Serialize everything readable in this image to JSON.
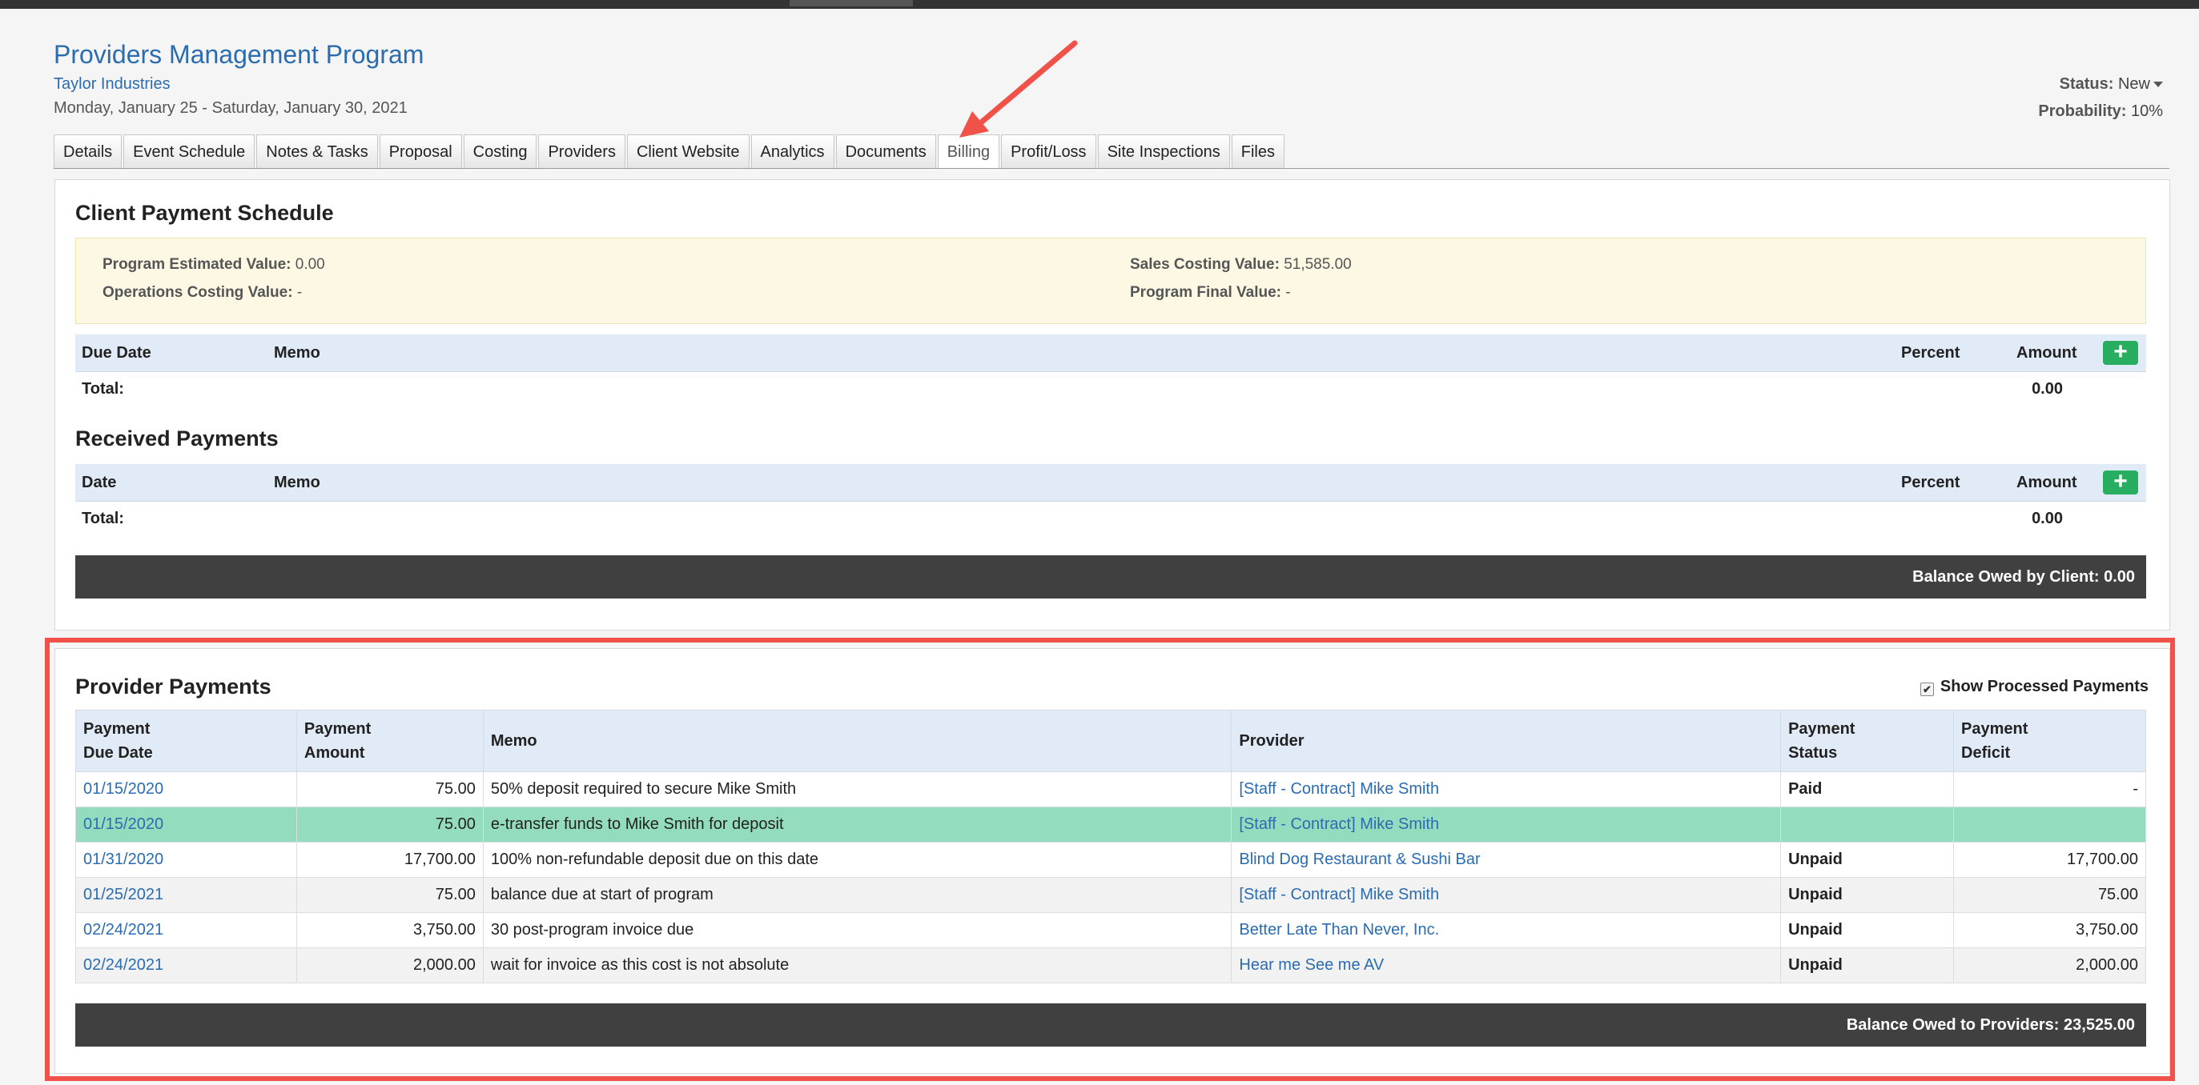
{
  "header": {
    "title": "Providers Management Program",
    "client": "Taylor Industries",
    "dates": "Monday, January 25 - Saturday, January 30, 2021",
    "status_label": "Status:",
    "status_value": "New",
    "probability_label": "Probability:",
    "probability_value": "10%"
  },
  "tabs": [
    {
      "label": "Details"
    },
    {
      "label": "Event Schedule"
    },
    {
      "label": "Notes & Tasks"
    },
    {
      "label": "Proposal"
    },
    {
      "label": "Costing"
    },
    {
      "label": "Providers"
    },
    {
      "label": "Client Website"
    },
    {
      "label": "Analytics"
    },
    {
      "label": "Documents"
    },
    {
      "label": "Billing"
    },
    {
      "label": "Profit/Loss"
    },
    {
      "label": "Site Inspections"
    },
    {
      "label": "Files"
    }
  ],
  "client_schedule": {
    "title": "Client Payment Schedule",
    "estimated_label": "Program Estimated Value:",
    "estimated_value": "0.00",
    "ops_label": "Operations Costing Value:",
    "ops_value": "-",
    "sales_label": "Sales Costing Value:",
    "sales_value": "51,585.00",
    "final_label": "Program Final Value:",
    "final_value": "-",
    "col_due": "Due Date",
    "col_memo": "Memo",
    "col_percent": "Percent",
    "col_amount": "Amount",
    "add_label": "+",
    "total_label": "Total:",
    "total_value": "0.00"
  },
  "received": {
    "title": "Received Payments",
    "col_date": "Date",
    "col_memo": "Memo",
    "col_percent": "Percent",
    "col_amount": "Amount",
    "add_label": "+",
    "total_label": "Total:",
    "total_value": "0.00",
    "balance": "Balance Owed by Client: 0.00"
  },
  "provider_payments": {
    "title": "Provider Payments",
    "show_processed": "Show Processed Payments",
    "show_processed_checked": true,
    "columns": {
      "due_1": "Payment",
      "due_2": "Due Date",
      "amt_1": "Payment",
      "amt_2": "Amount",
      "memo": "Memo",
      "provider": "Provider",
      "status_1": "Payment",
      "status_2": "Status",
      "deficit_1": "Payment",
      "deficit_2": "Deficit"
    },
    "rows": [
      {
        "due": "01/15/2020",
        "amount": "75.00",
        "memo": "50% deposit required to secure Mike Smith",
        "provider": "[Staff - Contract] Mike Smith",
        "status": "Paid",
        "deficit": "-"
      },
      {
        "due": "01/15/2020",
        "amount": "75.00",
        "memo": "e-transfer funds to Mike Smith for deposit",
        "provider": "[Staff - Contract] Mike Smith",
        "status": "",
        "deficit": ""
      },
      {
        "due": "01/31/2020",
        "amount": "17,700.00",
        "memo": "100% non-refundable deposit due on this date",
        "provider": "Blind Dog Restaurant & Sushi Bar",
        "status": "Unpaid",
        "deficit": "17,700.00"
      },
      {
        "due": "01/25/2021",
        "amount": "75.00",
        "memo": "balance due at start of program",
        "provider": "[Staff - Contract] Mike Smith",
        "status": "Unpaid",
        "deficit": "75.00"
      },
      {
        "due": "02/24/2021",
        "amount": "3,750.00",
        "memo": "30 post-program invoice due",
        "provider": "Better Late Than Never, Inc.",
        "status": "Unpaid",
        "deficit": "3,750.00"
      },
      {
        "due": "02/24/2021",
        "amount": "2,000.00",
        "memo": "wait for invoice as this cost is not absolute",
        "provider": "Hear me See me AV",
        "status": "Unpaid",
        "deficit": "2,000.00"
      }
    ],
    "balance": "Balance Owed to Providers: 23,525.00"
  },
  "colors": {
    "link": "#2b6cb0",
    "paid": "#1e8a2e",
    "unpaid": "#e01b1b",
    "highlight_row": "#94dcbe",
    "annotation": "#f0524a",
    "add_button": "#27ae60"
  }
}
